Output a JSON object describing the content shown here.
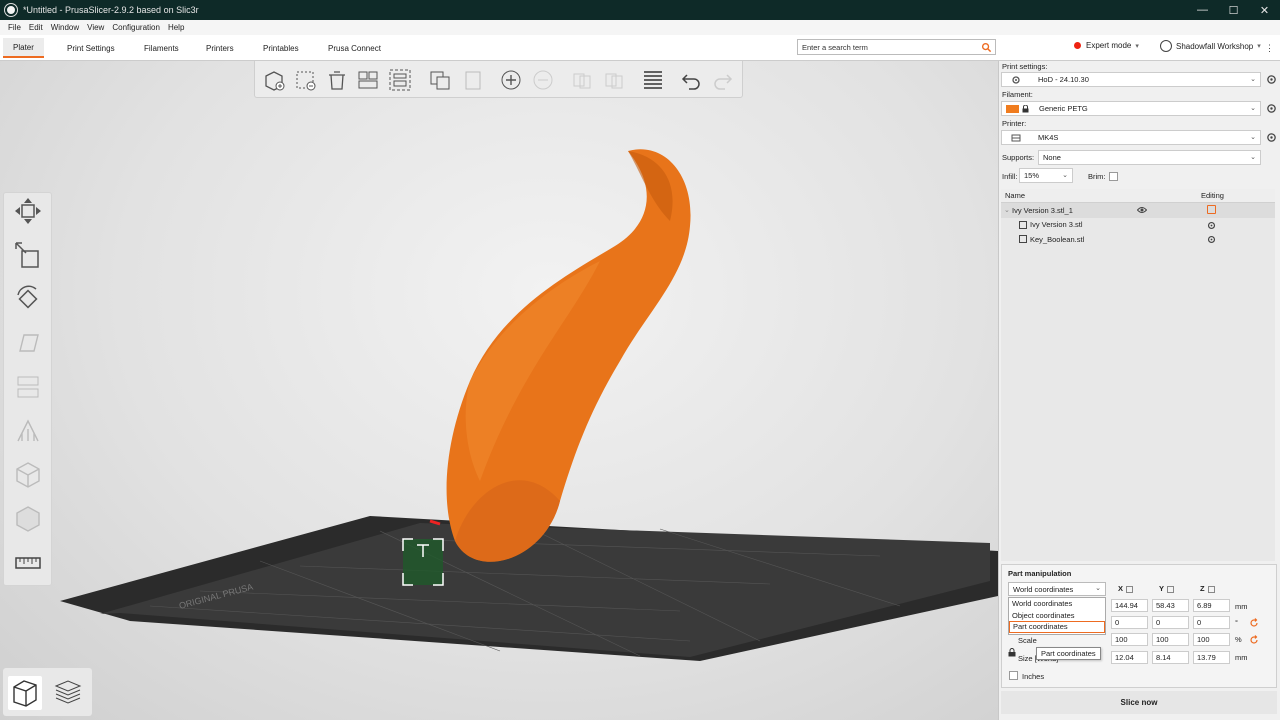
{
  "window": {
    "title": "*Untitled - PrusaSlicer-2.9.2 based on Slic3r",
    "controls": [
      "—",
      "☐",
      "✕"
    ]
  },
  "menu": [
    "File",
    "Edit",
    "Window",
    "View",
    "Configuration",
    "Help"
  ],
  "tabs": [
    {
      "label": "Plater",
      "active": true
    },
    {
      "label": "Print Settings",
      "active": false
    },
    {
      "label": "Filaments",
      "active": false
    },
    {
      "label": "Printers",
      "active": false
    },
    {
      "label": "Printables",
      "active": false
    },
    {
      "label": "Prusa Connect",
      "active": false
    }
  ],
  "search": {
    "placeholder": "Enter a search term"
  },
  "mode": {
    "label": "Expert mode",
    "color": "#e21111"
  },
  "workspace": {
    "label": "Shadowfall Workshop"
  },
  "toolbar_icons": [
    "add-icon",
    "delete-icon",
    "delete-all-icon",
    "arrange-icon",
    "arrange-selection-icon",
    "copy-icon",
    "paste-icon",
    "add-instance-icon",
    "remove-instance-icon",
    "split-objects-icon",
    "split-parts-icon",
    "layers-editing-icon",
    "undo-icon",
    "redo-icon"
  ],
  "left_tools": [
    "move-icon",
    "scale-icon",
    "rotate-icon",
    "place-on-face-icon",
    "cut-icon",
    "paint-supports-icon",
    "seam-painting-icon",
    "mmu-painting-icon",
    "measure-icon"
  ],
  "print_settings": {
    "label": "Print settings:",
    "value": "HoD - 24.10.30"
  },
  "filament": {
    "label": "Filament:",
    "value": "Generic PETG",
    "color": "#f07c1e"
  },
  "printer": {
    "label": "Printer:",
    "value": "MK4S"
  },
  "supports": {
    "label": "Supports:",
    "value": "None"
  },
  "infill": {
    "label": "Infill:",
    "value": "15%"
  },
  "brim": {
    "label": "Brim:"
  },
  "object_list": {
    "headers": {
      "name": "Name",
      "editing": "Editing"
    },
    "rows": [
      {
        "name": "Ivy Version 3.stl_1"
      },
      {
        "name": "Ivy Version 3.stl"
      },
      {
        "name": "Key_Boolean.stl"
      }
    ]
  },
  "part_manipulation": {
    "title": "Part manipulation",
    "coord_selected": "World coordinates",
    "coord_options": [
      "World coordinates",
      "Object coordinates",
      "Part coordinates"
    ],
    "tooltip": "Part coordinates",
    "axes": [
      "X",
      "Y",
      "Z"
    ],
    "position": {
      "values": [
        "144.94",
        "58.43",
        "6.89"
      ],
      "unit": "mm"
    },
    "rotation": {
      "values": [
        "0",
        "0",
        "0"
      ],
      "unit": "°"
    },
    "scale": {
      "label": "Scale",
      "values": [
        "100",
        "100",
        "100"
      ],
      "unit": "%"
    },
    "size": {
      "label": "Size [World]",
      "values": [
        "12.04",
        "8.14",
        "13.79"
      ],
      "unit": "mm"
    },
    "inches_label": "Inches"
  },
  "slice_button": "Slice now",
  "colors": {
    "accent": "#ed6b21",
    "model": "#e8741a"
  }
}
